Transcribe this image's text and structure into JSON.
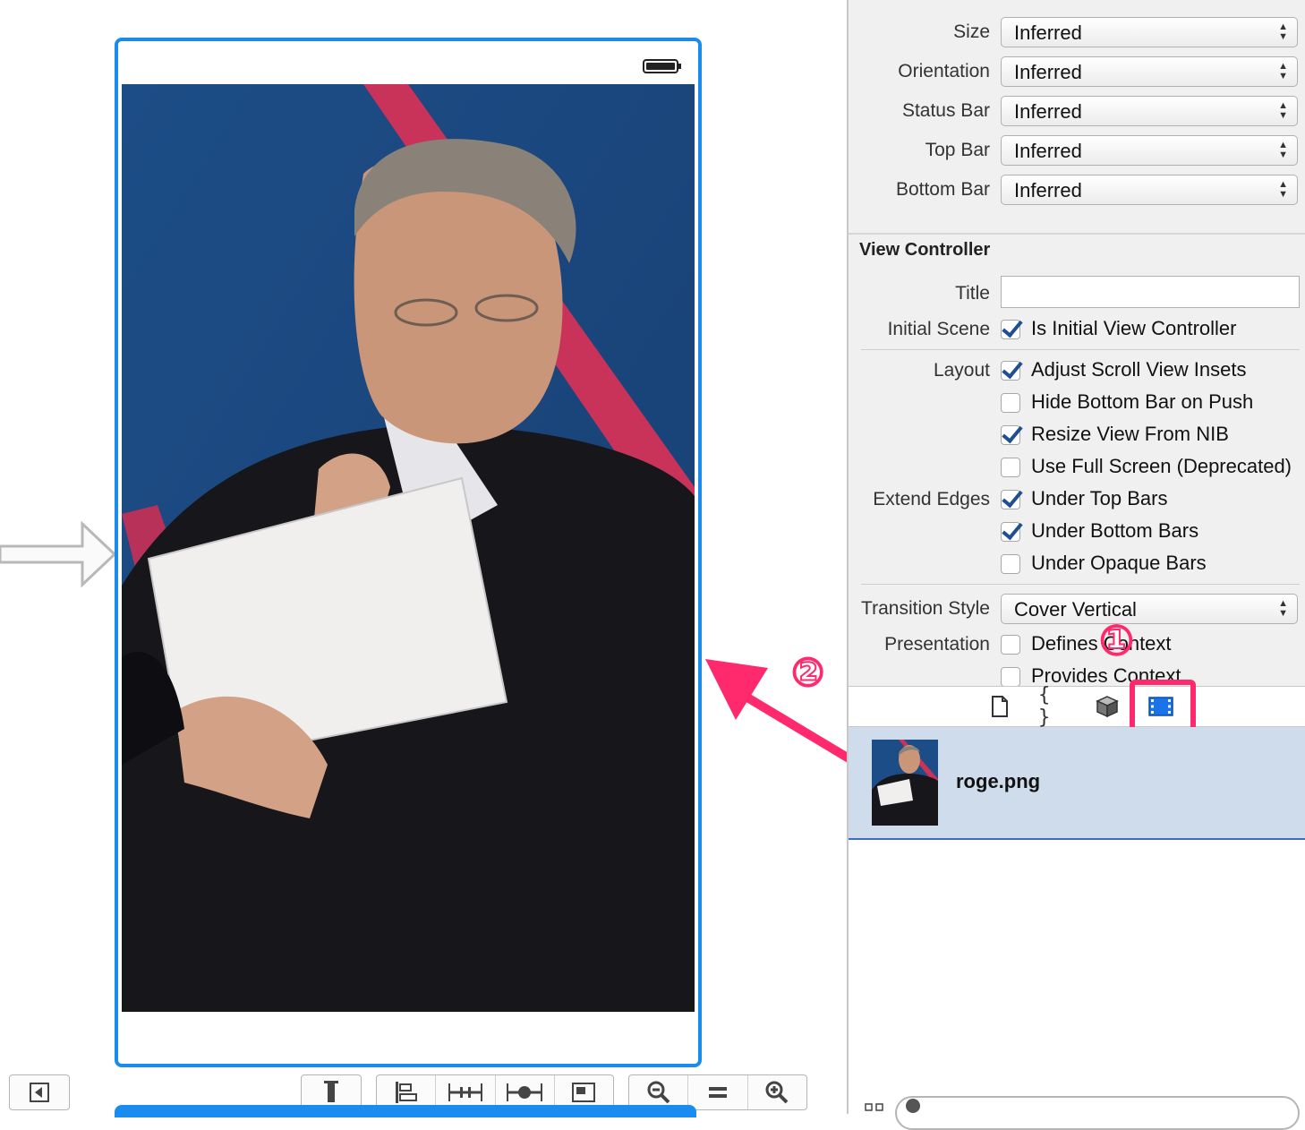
{
  "inspector": {
    "simulated_metrics": [
      {
        "label": "Size",
        "value": "Inferred"
      },
      {
        "label": "Orientation",
        "value": "Inferred"
      },
      {
        "label": "Status Bar",
        "value": "Inferred"
      },
      {
        "label": "Top Bar",
        "value": "Inferred"
      },
      {
        "label": "Bottom Bar",
        "value": "Inferred"
      }
    ],
    "view_controller": {
      "section_title": "View Controller",
      "title_label": "Title",
      "title_value": "",
      "initial_scene_label": "Initial Scene",
      "initial_scene": {
        "label": "Is Initial View Controller",
        "checked": true
      },
      "layout_label": "Layout",
      "layout_options": [
        {
          "label": "Adjust Scroll View Insets",
          "checked": true
        },
        {
          "label": "Hide Bottom Bar on Push",
          "checked": false
        },
        {
          "label": "Resize View From NIB",
          "checked": true
        },
        {
          "label": "Use Full Screen (Deprecated)",
          "checked": false
        }
      ],
      "extend_edges_label": "Extend Edges",
      "extend_edges": [
        {
          "label": "Under Top Bars",
          "checked": true
        },
        {
          "label": "Under Bottom Bars",
          "checked": true
        },
        {
          "label": "Under Opaque Bars",
          "checked": false
        }
      ],
      "transition_style_label": "Transition Style",
      "transition_style_value": "Cover Vertical",
      "presentation_label": "Presentation",
      "presentation": [
        {
          "label": "Defines Context",
          "checked": false
        },
        {
          "label": "Provides Context",
          "checked": false
        }
      ]
    },
    "library": {
      "tabs": [
        "file-template-icon",
        "code-snippet-icon",
        "object-cube-icon",
        "media-film-icon"
      ],
      "selected_tab": "media-film-icon",
      "items": [
        {
          "name": "roge.png"
        }
      ]
    }
  },
  "annotations": {
    "marker_1": "①",
    "marker_2": "②"
  },
  "colors": {
    "selection_blue": "#1a8cf0",
    "annotation_pink": "#ff2a6d",
    "library_row": "#cfdcec"
  }
}
